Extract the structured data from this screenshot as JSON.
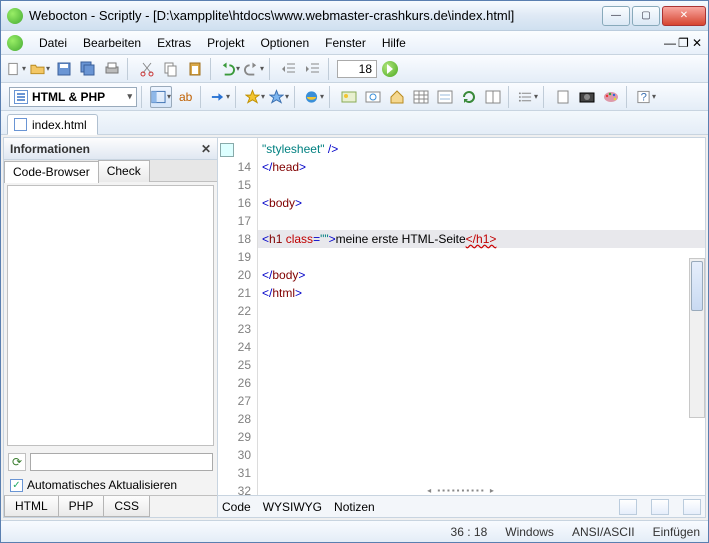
{
  "window": {
    "title": "Webocton - Scriptly - [D:\\xampplite\\htdocs\\www.webmaster-crashkurs.de\\index.html]"
  },
  "menu": {
    "items": [
      "Datei",
      "Bearbeiten",
      "Extras",
      "Projekt",
      "Optionen",
      "Fenster",
      "Hilfe"
    ]
  },
  "toolbar": {
    "line_no": "18"
  },
  "language_selector": "HTML & PHP",
  "filetab": "index.html",
  "side": {
    "title": "Informationen",
    "tabs": [
      "Code-Browser",
      "Check"
    ],
    "checkbox": "Automatisches Aktualisieren",
    "langtabs": [
      "HTML",
      "PHP",
      "CSS"
    ]
  },
  "code": {
    "first_line_no": 13,
    "lines": [
      {
        "n": "",
        "html": "<span class='tok-s'>\"stylesheet\"</span> <span class='tok-p'>/&gt;</span>",
        "mark": true
      },
      {
        "n": "14",
        "html": "<span class='tok-p'>&lt;/</span><span class='tok-t'>head</span><span class='tok-p'>&gt;</span>"
      },
      {
        "n": "15",
        "html": ""
      },
      {
        "n": "16",
        "html": "<span class='tok-p'>&lt;</span><span class='tok-t'>body</span><span class='tok-p'>&gt;</span>"
      },
      {
        "n": "17",
        "html": ""
      },
      {
        "n": "18",
        "html": "<span class='tok-p'>&lt;</span><span class='tok-t'>h1</span> <span class='tok-a'>class</span><span class='tok-p'>=</span><span class='tok-s'>\"\"</span><span class='tok-p'>&gt;</span>meine erste HTML-Seite<span class='tok-err'>&lt;/h1&gt;</span>",
        "hl": true
      },
      {
        "n": "19",
        "html": ""
      },
      {
        "n": "20",
        "html": "<span class='tok-p'>&lt;/</span><span class='tok-t'>body</span><span class='tok-p'>&gt;</span>"
      },
      {
        "n": "21",
        "html": "<span class='tok-p'>&lt;/</span><span class='tok-t'>html</span><span class='tok-p'>&gt;</span>"
      },
      {
        "n": "22",
        "html": ""
      },
      {
        "n": "23",
        "html": ""
      },
      {
        "n": "24",
        "html": ""
      },
      {
        "n": "25",
        "html": ""
      },
      {
        "n": "26",
        "html": ""
      },
      {
        "n": "27",
        "html": ""
      },
      {
        "n": "28",
        "html": ""
      },
      {
        "n": "29",
        "html": ""
      },
      {
        "n": "30",
        "html": ""
      },
      {
        "n": "31",
        "html": ""
      },
      {
        "n": "32",
        "html": ""
      }
    ]
  },
  "bottomtabs": [
    "Code",
    "WYSIWYG",
    "Notizen"
  ],
  "status": {
    "pos": "36 : 18",
    "os": "Windows",
    "enc": "ANSI/ASCII",
    "mode": "Einfügen"
  }
}
